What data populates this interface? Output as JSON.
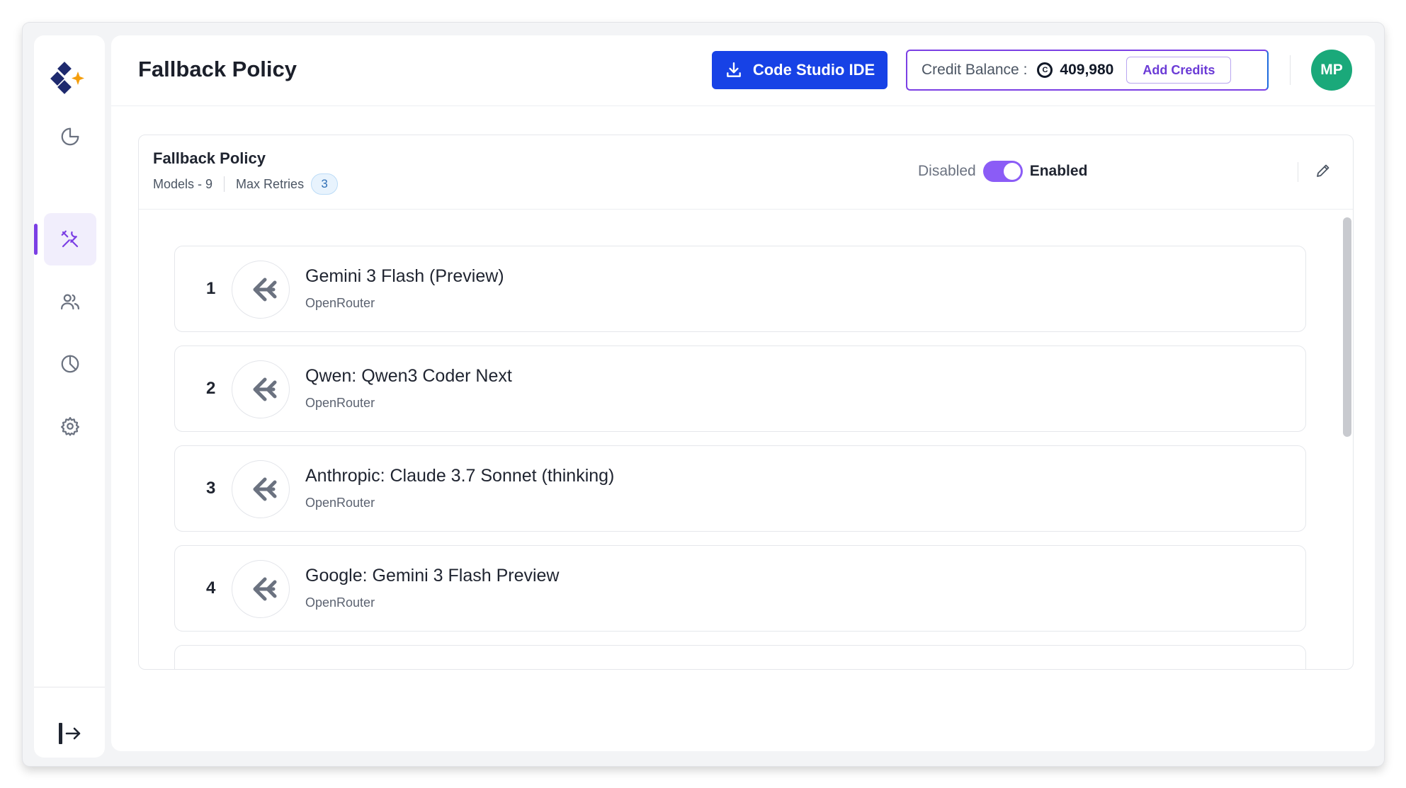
{
  "page": {
    "title": "Fallback Policy"
  },
  "header": {
    "code_studio_label": "Code Studio IDE",
    "credit_label": "Credit Balance :",
    "credit_value": "409,980",
    "add_credits_label": "Add Credits",
    "avatar_initials": "MP"
  },
  "sidebar": {
    "items": [
      {
        "icon": "pie-chart-icon"
      },
      {
        "icon": "tools-icon",
        "active": true
      },
      {
        "icon": "users-icon"
      },
      {
        "icon": "analytics-icon"
      },
      {
        "icon": "gear-icon"
      }
    ],
    "logout_icon": "logout-icon"
  },
  "policy": {
    "title": "Fallback Policy",
    "models_label": "Models - 9",
    "max_retries_label": "Max Retries",
    "max_retries_value": "3",
    "toggle_off_label": "Disabled",
    "toggle_on_label": "Enabled",
    "enabled": true
  },
  "models": [
    {
      "index": "1",
      "name": "Gemini 3 Flash (Preview)",
      "provider": "OpenRouter"
    },
    {
      "index": "2",
      "name": "Qwen: Qwen3 Coder Next",
      "provider": "OpenRouter"
    },
    {
      "index": "3",
      "name": "Anthropic: Claude 3.7 Sonnet (thinking)",
      "provider": "OpenRouter"
    },
    {
      "index": "4",
      "name": "Google: Gemini 3 Flash Preview",
      "provider": "OpenRouter"
    }
  ],
  "colors": {
    "accent": "#7b3fe4",
    "primary_button": "#1742e6",
    "avatar": "#1aa97a"
  }
}
